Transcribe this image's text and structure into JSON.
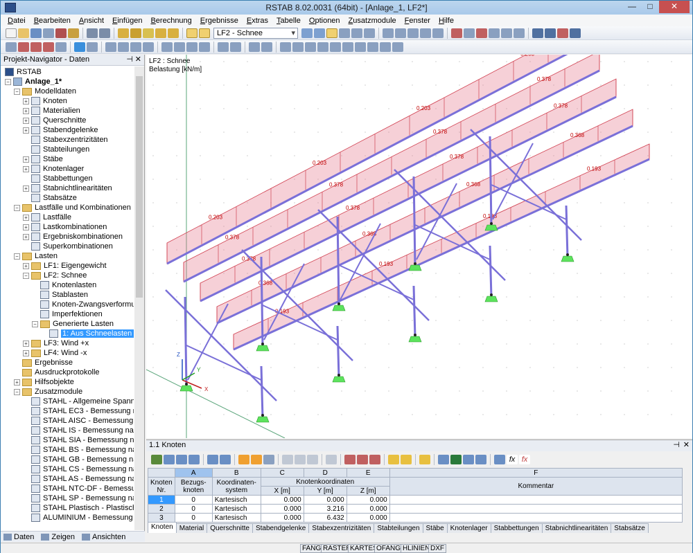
{
  "app": {
    "title": "RSTAB 8.02.0031 (64bit) - [Anlage_1, LF2*]"
  },
  "menu": [
    "Datei",
    "Bearbeiten",
    "Ansicht",
    "Einfügen",
    "Berechnung",
    "Ergebnisse",
    "Extras",
    "Tabelle",
    "Optionen",
    "Zusatzmodule",
    "Fenster",
    "Hilfe"
  ],
  "toolbar": {
    "loadcase_select": "LF2 - Schnee"
  },
  "navigator": {
    "title": "Projekt-Navigator - Daten",
    "items": [
      {
        "label": "RSTAB",
        "level": 0,
        "exp": "",
        "icon": "app"
      },
      {
        "label": "Anlage_1*",
        "level": 0,
        "exp": "−",
        "icon": "model",
        "bold": true
      },
      {
        "label": "Modelldaten",
        "level": 1,
        "exp": "−",
        "icon": "folder"
      },
      {
        "label": "Knoten",
        "level": 2,
        "exp": "+",
        "icon": "item"
      },
      {
        "label": "Materialien",
        "level": 2,
        "exp": "+",
        "icon": "item"
      },
      {
        "label": "Querschnitte",
        "level": 2,
        "exp": "+",
        "icon": "item"
      },
      {
        "label": "Stabendgelenke",
        "level": 2,
        "exp": "+",
        "icon": "item"
      },
      {
        "label": "Stabexzentrizitäten",
        "level": 2,
        "exp": "",
        "icon": "item"
      },
      {
        "label": "Stabteilungen",
        "level": 2,
        "exp": "",
        "icon": "item"
      },
      {
        "label": "Stäbe",
        "level": 2,
        "exp": "+",
        "icon": "item"
      },
      {
        "label": "Knotenlager",
        "level": 2,
        "exp": "+",
        "icon": "item"
      },
      {
        "label": "Stabbettungen",
        "level": 2,
        "exp": "",
        "icon": "item"
      },
      {
        "label": "Stabnichtlinearitäten",
        "level": 2,
        "exp": "+",
        "icon": "item"
      },
      {
        "label": "Stabsätze",
        "level": 2,
        "exp": "",
        "icon": "item"
      },
      {
        "label": "Lastfälle und Kombinationen",
        "level": 1,
        "exp": "−",
        "icon": "folder"
      },
      {
        "label": "Lastfälle",
        "level": 2,
        "exp": "+",
        "icon": "item"
      },
      {
        "label": "Lastkombinationen",
        "level": 2,
        "exp": "+",
        "icon": "item"
      },
      {
        "label": "Ergebniskombinationen",
        "level": 2,
        "exp": "+",
        "icon": "item"
      },
      {
        "label": "Superkombinationen",
        "level": 2,
        "exp": "",
        "icon": "item"
      },
      {
        "label": "Lasten",
        "level": 1,
        "exp": "−",
        "icon": "folder"
      },
      {
        "label": "LF1: Eigengewicht",
        "level": 2,
        "exp": "+",
        "icon": "folder"
      },
      {
        "label": "LF2: Schnee",
        "level": 2,
        "exp": "−",
        "icon": "folder"
      },
      {
        "label": "Knotenlasten",
        "level": 3,
        "exp": "",
        "icon": "item"
      },
      {
        "label": "Stablasten",
        "level": 3,
        "exp": "",
        "icon": "item"
      },
      {
        "label": "Knoten-Zwangsverformun",
        "level": 3,
        "exp": "",
        "icon": "item"
      },
      {
        "label": "Imperfektionen",
        "level": 3,
        "exp": "",
        "icon": "item"
      },
      {
        "label": "Generierte Lasten",
        "level": 3,
        "exp": "−",
        "icon": "folder"
      },
      {
        "label": "1: Aus Schneelasten (Fl",
        "level": 4,
        "exp": "",
        "icon": "item",
        "selected": true
      },
      {
        "label": "LF3: Wind +x",
        "level": 2,
        "exp": "+",
        "icon": "folder"
      },
      {
        "label": "LF4: Wind -x",
        "level": 2,
        "exp": "+",
        "icon": "folder"
      },
      {
        "label": "Ergebnisse",
        "level": 1,
        "exp": "",
        "icon": "folder"
      },
      {
        "label": "Ausdruckprotokolle",
        "level": 1,
        "exp": "",
        "icon": "folder"
      },
      {
        "label": "Hilfsobjekte",
        "level": 1,
        "exp": "+",
        "icon": "folder"
      },
      {
        "label": "Zusatzmodule",
        "level": 1,
        "exp": "−",
        "icon": "folder"
      },
      {
        "label": "STAHL - Allgemeine Spannun",
        "level": 2,
        "exp": "",
        "icon": "item"
      },
      {
        "label": "STAHL EC3 - Bemessung nach",
        "level": 2,
        "exp": "",
        "icon": "item"
      },
      {
        "label": "STAHL AISC - Bemessung nach",
        "level": 2,
        "exp": "",
        "icon": "item"
      },
      {
        "label": "STAHL IS - Bemessung nach IS",
        "level": 2,
        "exp": "",
        "icon": "item"
      },
      {
        "label": "STAHL SIA - Bemessung nach",
        "level": 2,
        "exp": "",
        "icon": "item"
      },
      {
        "label": "STAHL BS - Bemessung nach I",
        "level": 2,
        "exp": "",
        "icon": "item"
      },
      {
        "label": "STAHL GB - Bemessung nach",
        "level": 2,
        "exp": "",
        "icon": "item"
      },
      {
        "label": "STAHL CS - Bemessung nach",
        "level": 2,
        "exp": "",
        "icon": "item"
      },
      {
        "label": "STAHL AS - Bemessung nach .",
        "level": 2,
        "exp": "",
        "icon": "item"
      },
      {
        "label": "STAHL NTC-DF - Bemessung",
        "level": 2,
        "exp": "",
        "icon": "item"
      },
      {
        "label": "STAHL SP - Bemessung nach S",
        "level": 2,
        "exp": "",
        "icon": "item"
      },
      {
        "label": "STAHL Plastisch - Plastische B",
        "level": 2,
        "exp": "",
        "icon": "item"
      },
      {
        "label": "ALUMINIUM - Bemessung nac",
        "level": 2,
        "exp": "",
        "icon": "item"
      }
    ],
    "tabs": [
      "Daten",
      "Zeigen",
      "Ansichten"
    ]
  },
  "view": {
    "line1": "LF2 : Schnee",
    "line2": "Belastung [kN/m]",
    "load_labels": [
      "0.203",
      "0.378",
      "0.378",
      "0.368",
      "0.193"
    ],
    "axes": [
      "X",
      "Y",
      "Z"
    ]
  },
  "table_panel": {
    "title": "1.1 Knoten",
    "col_letters": [
      "A",
      "B",
      "C",
      "D",
      "E",
      "F"
    ],
    "headers": {
      "nr": "Knoten Nr.",
      "bezug": "Bezugs-knoten",
      "system": "Koordinaten-system",
      "coords": "Knotenkoordinaten",
      "x": "X [m]",
      "y": "Y [m]",
      "z": "Z [m]",
      "kommentar": "Kommentar"
    },
    "rows": [
      {
        "nr": "1",
        "bezug": "0",
        "system": "Kartesisch",
        "x": "0.000",
        "y": "0.000",
        "z": "0.000"
      },
      {
        "nr": "2",
        "bezug": "0",
        "system": "Kartesisch",
        "x": "0.000",
        "y": "3.216",
        "z": "0.000"
      },
      {
        "nr": "3",
        "bezug": "0",
        "system": "Kartesisch",
        "x": "0.000",
        "y": "6.432",
        "z": "0.000"
      }
    ],
    "tabs": [
      "Knoten",
      "Material",
      "Querschnitte",
      "Stabendgelenke",
      "Stabexzentrizitäten",
      "Stabteilungen",
      "Stäbe",
      "Knotenlager",
      "Stabbettungen",
      "Stabnichtlinearitäten",
      "Stabsätze"
    ]
  },
  "statusbar": [
    "FANG",
    "RASTER",
    "KARTES",
    "OFANG",
    "HLINIEN",
    "DXF"
  ]
}
